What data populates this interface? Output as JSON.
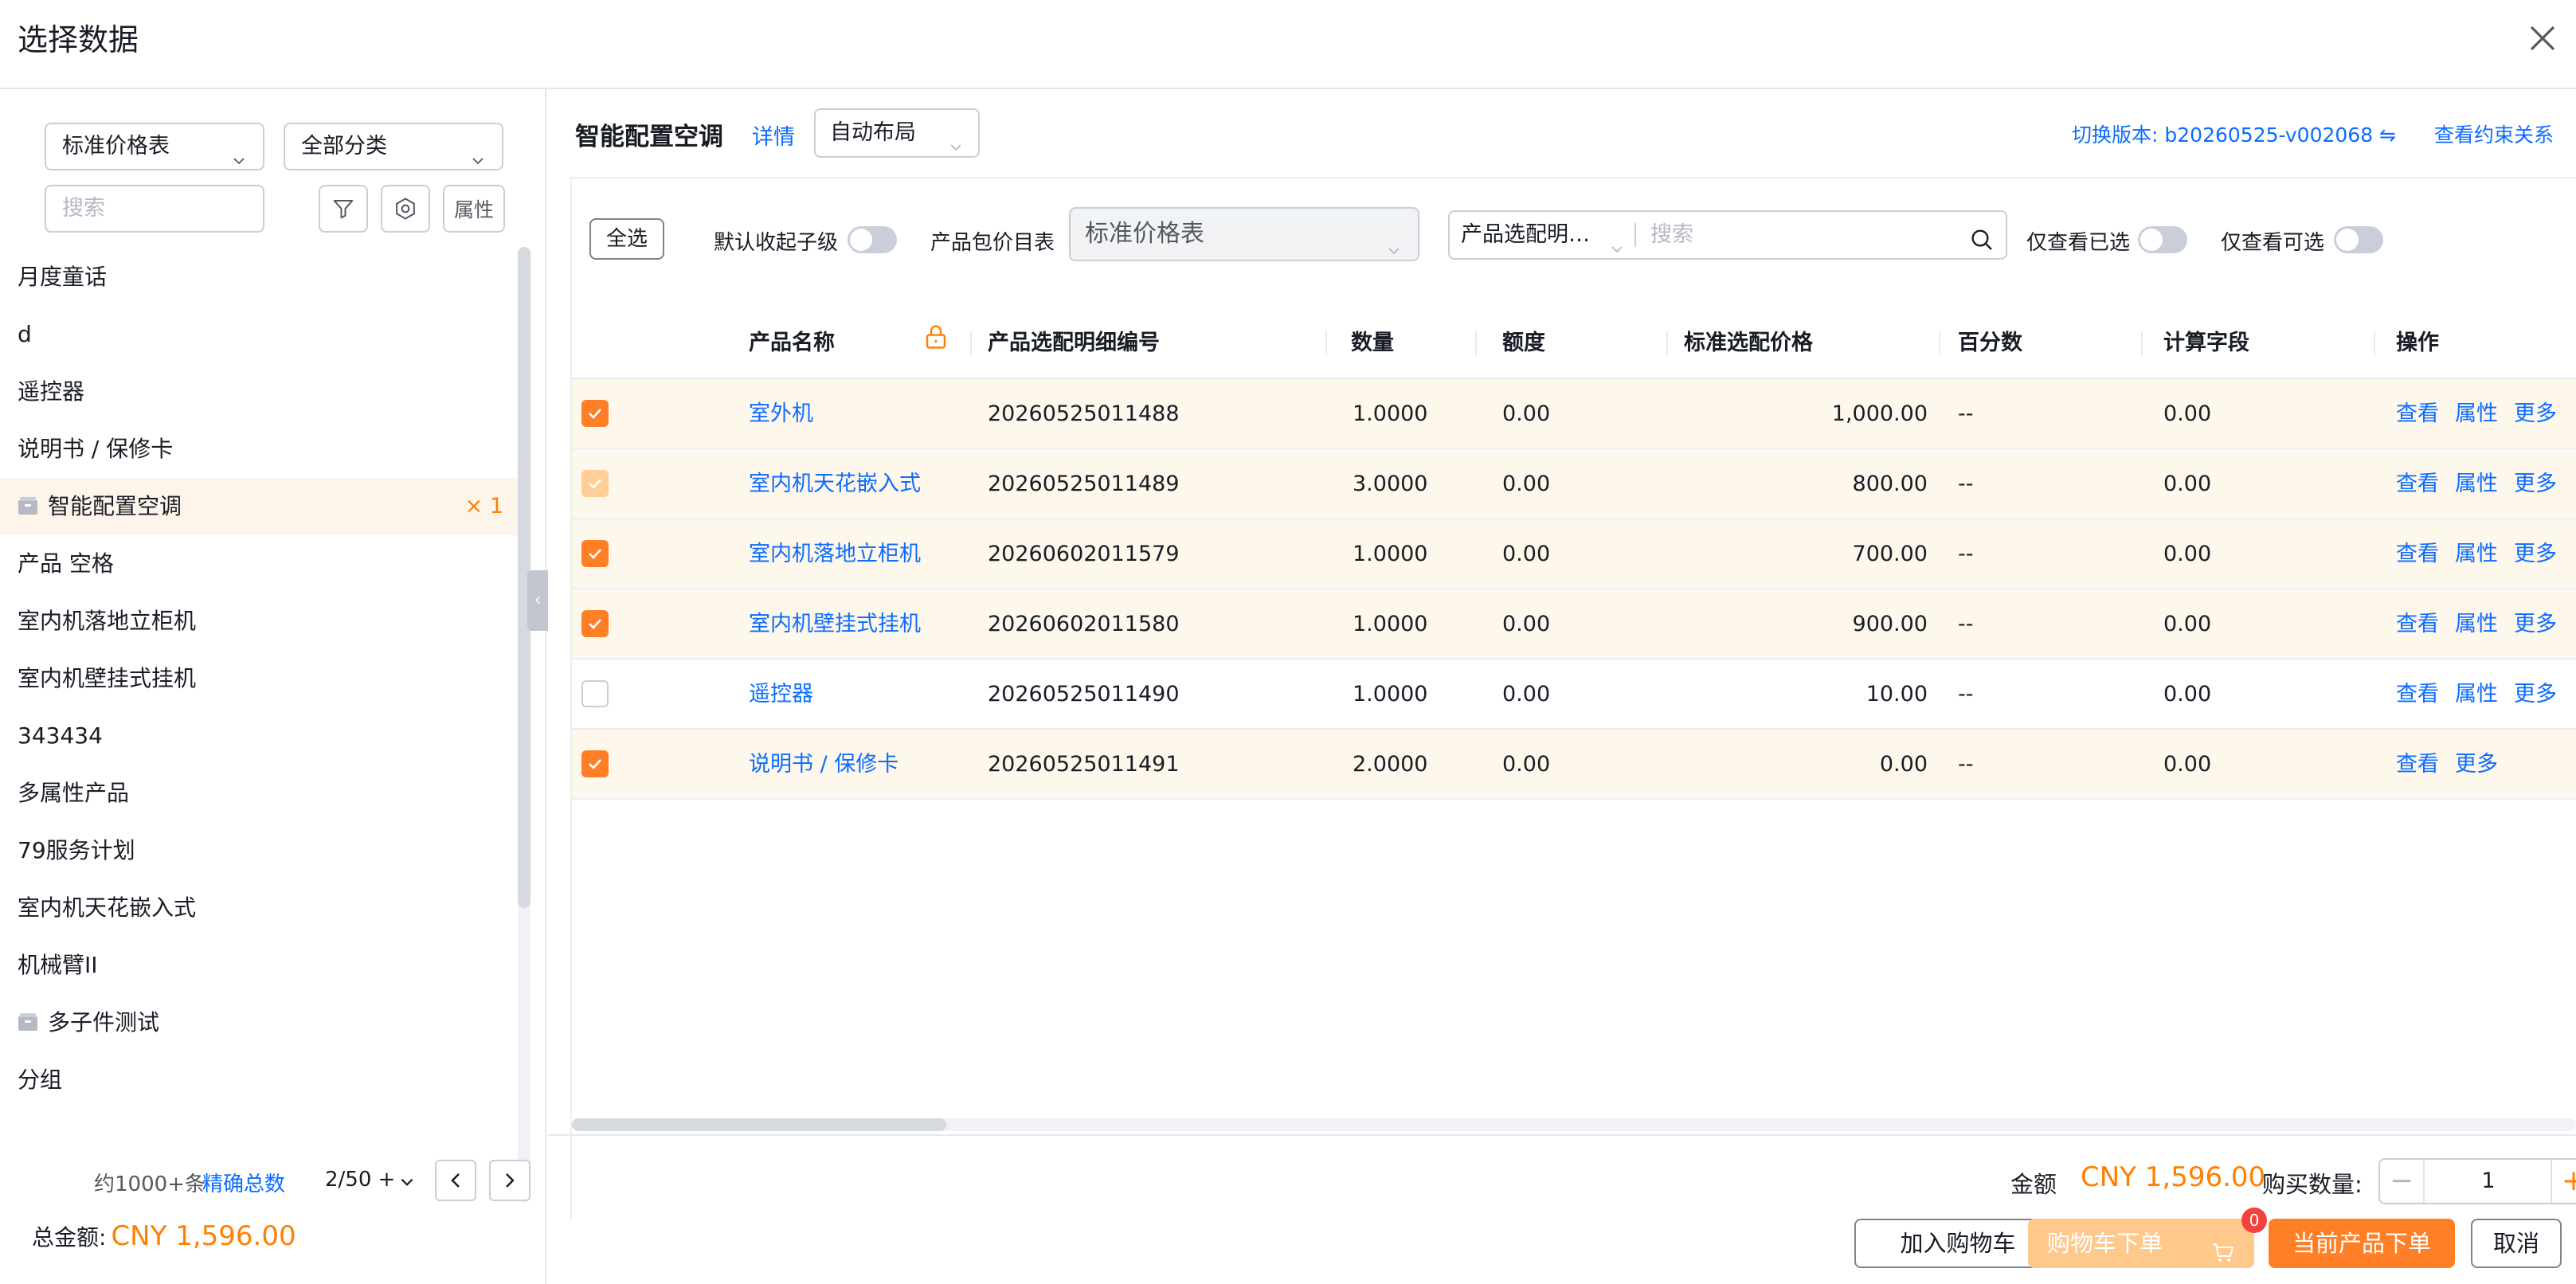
{
  "dialog": {
    "title": "选择数据"
  },
  "left": {
    "price_select": "标准价格表",
    "category_select": "全部分类",
    "search_placeholder": "搜索",
    "attr_button": "属性",
    "items": [
      {
        "label": "月度童话"
      },
      {
        "label": "d"
      },
      {
        "label": "遥控器"
      },
      {
        "label": "说明书 / 保修卡"
      },
      {
        "label": "智能配置空调",
        "count": "× 1",
        "active": true,
        "icon": "package-icon"
      },
      {
        "label": "产品 空格"
      },
      {
        "label": "室内机落地立柜机"
      },
      {
        "label": "室内机壁挂式挂机"
      },
      {
        "label": "343434"
      },
      {
        "label": "多属性产品"
      },
      {
        "label": "79服务计划"
      },
      {
        "label": "室内机天花嵌入式"
      },
      {
        "label": "机械臂II"
      },
      {
        "label": "多子件测试",
        "icon": "package-icon"
      },
      {
        "label": "分组"
      }
    ],
    "pager": {
      "approx": "约1000+条",
      "exact_link": "精确总数",
      "page": "2/50 +"
    },
    "total_label": "总金额:",
    "total_value": "CNY 1,596.00"
  },
  "main": {
    "title": "智能配置空调",
    "detail_link": "详情",
    "layout_select": "自动布局",
    "version_link": "切换版本: b20260525-v002068 ⇋",
    "relation_link": "查看约束关系",
    "toolbar": {
      "select_all": "全选",
      "collapse_label": "默认收起子级",
      "pricelist_label": "产品包价目表",
      "pricelist_value": "标准价格表",
      "search_option": "产品选配明…",
      "search_placeholder": "搜索",
      "only_selected": "仅查看已选",
      "only_available": "仅查看可选"
    },
    "columns": [
      "产品名称",
      "产品选配明细编号",
      "数量",
      "额度",
      "标准选配价格",
      "百分数",
      "计算字段",
      "操作"
    ],
    "rows": [
      {
        "name": "室外机",
        "code": "20260525011488",
        "qty": "1.0000",
        "quota": "0.00",
        "price": "1,000.00",
        "pct": "--",
        "calc": "0.00",
        "checked": "checked",
        "actions": [
          "查看",
          "属性",
          "更多"
        ]
      },
      {
        "name": "室内机天花嵌入式",
        "code": "20260525011489",
        "qty": "3.0000",
        "quota": "0.00",
        "price": "800.00",
        "pct": "--",
        "calc": "0.00",
        "checked": "disabled",
        "actions": [
          "查看",
          "属性",
          "更多"
        ]
      },
      {
        "name": "室内机落地立柜机",
        "code": "20260602011579",
        "qty": "1.0000",
        "quota": "0.00",
        "price": "700.00",
        "pct": "--",
        "calc": "0.00",
        "checked": "checked",
        "actions": [
          "查看",
          "属性",
          "更多"
        ]
      },
      {
        "name": "室内机壁挂式挂机",
        "code": "20260602011580",
        "qty": "1.0000",
        "quota": "0.00",
        "price": "900.00",
        "pct": "--",
        "calc": "0.00",
        "checked": "checked",
        "actions": [
          "查看",
          "属性",
          "更多"
        ]
      },
      {
        "name": "遥控器",
        "code": "20260525011490",
        "qty": "1.0000",
        "quota": "0.00",
        "price": "10.00",
        "pct": "--",
        "calc": "0.00",
        "checked": "unchecked",
        "actions": [
          "查看",
          "属性",
          "更多"
        ]
      },
      {
        "name": "说明书 / 保修卡",
        "code": "20260525011491",
        "qty": "2.0000",
        "quota": "0.00",
        "price": "0.00",
        "pct": "--",
        "calc": "0.00",
        "checked": "checked",
        "actions": [
          "查看",
          "更多"
        ]
      }
    ]
  },
  "footer": {
    "amount_label": "金额",
    "amount_value": "CNY 1,596.00",
    "qty_label": "购买数量:",
    "qty_value": "1",
    "minus": "−",
    "plus": "+",
    "add_cart": "加入购物车",
    "cart_order": "购物车下单",
    "cart_badge": "0",
    "order_now": "当前产品下单",
    "cancel": "取消"
  },
  "colors": {
    "accent": "#ff7f27",
    "link": "#0c6cff",
    "active_row": "#fef5ea"
  }
}
